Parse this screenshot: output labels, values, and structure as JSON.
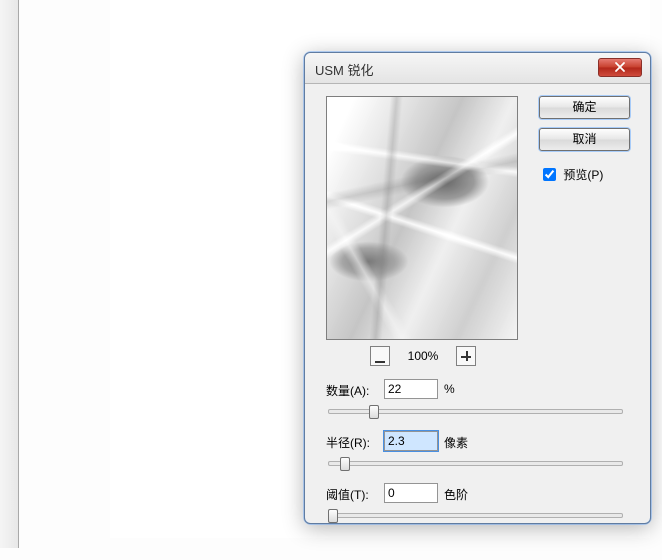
{
  "dialog": {
    "title": "USM 锐化",
    "ok_label": "确定",
    "cancel_label": "取消",
    "preview_label": "预览(P)",
    "preview_checked": true,
    "zoom_label": "100%"
  },
  "fields": {
    "amount": {
      "label": "数量(A):",
      "value": "22",
      "unit": "%"
    },
    "radius": {
      "label": "半径(R):",
      "value": "2.3",
      "unit": "像素"
    },
    "threshold": {
      "label": "阈值(T):",
      "value": "0",
      "unit": "色阶"
    }
  }
}
